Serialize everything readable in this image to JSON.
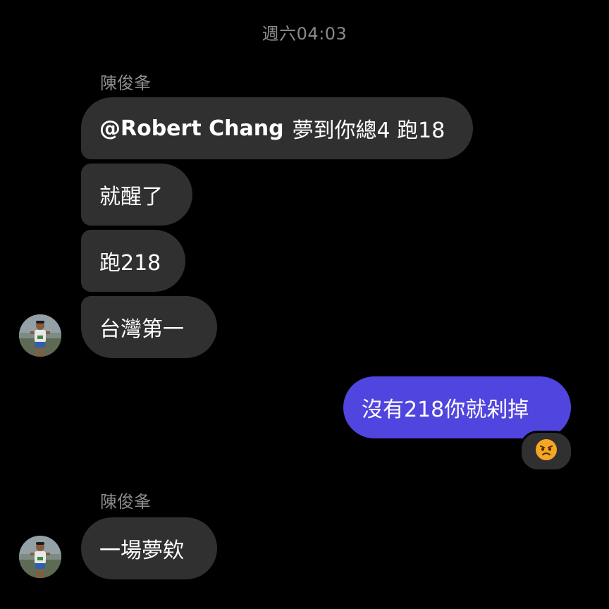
{
  "timestamp": "週六04:03",
  "groups": [
    {
      "sender": "陳俊夆",
      "messages": [
        {
          "mention": "@Robert Chang",
          "text": "夢到你總4 跑18"
        },
        {
          "text": "就醒了"
        },
        {
          "text": "跑218"
        },
        {
          "text": "台灣第一"
        }
      ]
    },
    {
      "sender": "陳俊夆",
      "messages": [
        {
          "text": "一場夢欸"
        }
      ]
    }
  ],
  "outgoing": {
    "text": "沒有218你就剁掉",
    "reaction_icon": "angry-face-icon"
  },
  "colors": {
    "background": "#000000",
    "incoming_bubble": "#303030",
    "outgoing_bubble": "#5145e0",
    "muted_text": "#8e8e8e",
    "reaction_emoji": "#f5a623"
  }
}
